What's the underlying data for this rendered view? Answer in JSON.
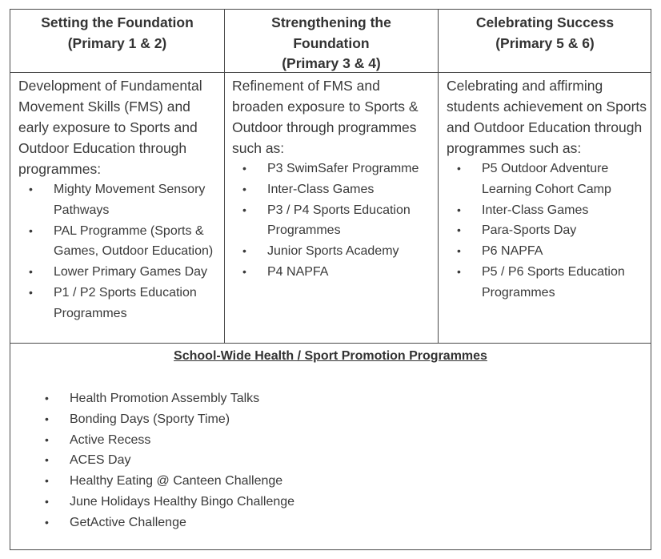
{
  "columns": [
    {
      "title_line1": "Setting the Foundation",
      "title_line2": "(Primary 1 & 2)",
      "title_line3": "",
      "intro": "Development of Fundamental Movement Skills (FMS) and early exposure to Sports and Outdoor Education through programmes:",
      "items": [
        "Mighty Movement Sensory Pathways",
        "PAL Programme (Sports & Games, Outdoor Education)",
        "Lower Primary Games Day",
        "P1 / P2 Sports Education Programmes"
      ]
    },
    {
      "title_line1": "Strengthening the",
      "title_line2": "Foundation",
      "title_line3": "(Primary 3 & 4)",
      "intro": "Refinement of FMS and broaden exposure to Sports & Outdoor through programmes such as:",
      "items": [
        "P3 SwimSafer Programme",
        "Inter-Class Games",
        "P3 / P4 Sports Education Programmes",
        "Junior Sports Academy",
        "P4 NAPFA"
      ]
    },
    {
      "title_line1": "Celebrating Success",
      "title_line2": "(Primary 5 & 6)",
      "title_line3": "",
      "intro": "Celebrating and affirming students achievement on Sports and Outdoor Education through programmes such as:",
      "items": [
        "P5 Outdoor Adventure Learning Cohort Camp",
        "Inter-Class Games",
        "Para-Sports Day",
        "P6 NAPFA",
        "P5 / P6 Sports Education Programmes"
      ]
    }
  ],
  "school_wide": {
    "title": "School-Wide Health / Sport Promotion Programmes",
    "items": [
      "Health Promotion Assembly Talks",
      "Bonding Days (Sporty Time)",
      "Active Recess",
      "ACES Day",
      "Healthy Eating @ Canteen Challenge",
      "June Holidays Healthy Bingo Challenge",
      "GetActive Challenge"
    ]
  },
  "bullet_glyph": "•"
}
